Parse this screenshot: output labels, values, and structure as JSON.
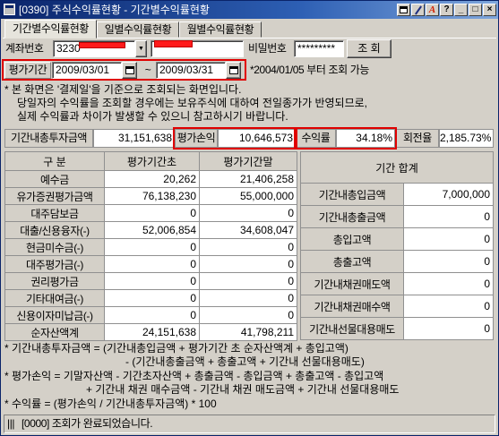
{
  "colors": {
    "title_bar": "#0a246a",
    "highlight": "#e00000",
    "redaction": "#ff1a1a",
    "panel": "#d4d0c8"
  },
  "window": {
    "title": "[0390] 주식수익률현황 - 기간별수익률현황",
    "title_buttons": [
      {
        "icon": "window-icon"
      },
      {
        "icon": "link-icon"
      },
      {
        "icon": "font-icon",
        "glyph": "A"
      },
      {
        "icon": "help-icon",
        "glyph": "?"
      },
      {
        "icon": "minimize-icon",
        "glyph": "_"
      },
      {
        "icon": "maximize-icon",
        "glyph": "□"
      },
      {
        "icon": "close-icon",
        "glyph": "×"
      }
    ]
  },
  "tabs": [
    {
      "label": "기간별수익률현황",
      "active": true
    },
    {
      "label": "일별수익률현황",
      "active": false
    },
    {
      "label": "월별수익률현황",
      "active": false
    }
  ],
  "account": {
    "label": "계좌번호",
    "number": "3230",
    "dropdown_glyph": "▼",
    "password_label": "비밀번호",
    "password": "*********",
    "search_button": "조 회"
  },
  "period": {
    "label": "평가기간",
    "start": "2009/03/01",
    "separator": "~",
    "end": "2009/03/31",
    "note": "*2004/01/05 부터 조회 가능"
  },
  "notes": [
    "* 본 화면은 '결제일'을 기준으로 조회되는 화면입니다.",
    "당일자의 수익률을 조회할 경우에는 보유주식에 대하여 전일종가가 반영되므로,",
    "실제 수익률과 차이가 발생할 수 있으니 참고하시기 바랍니다."
  ],
  "summary": {
    "total_investment": {
      "label": "기간내총투자금액",
      "value": "31,151,638"
    },
    "profit_loss": {
      "label": "평가손익",
      "value": "10,646,573"
    },
    "return_rate": {
      "label": "수익률",
      "value": "34.18%"
    },
    "turnover": {
      "label": "회전율",
      "value": "2,185.73%"
    }
  },
  "asset_table": {
    "headers": [
      "구 분",
      "평가기간초",
      "평가기간말"
    ],
    "rows": [
      {
        "label": "예수금",
        "start": "20,262",
        "end": "21,406,258"
      },
      {
        "label": "유가증권평가금액",
        "start": "76,138,230",
        "end": "55,000,000"
      },
      {
        "label": "대주담보금",
        "start": "0",
        "end": "0"
      },
      {
        "label": "대출/신용융자(-)",
        "start": "52,006,854",
        "end": "34,608,047"
      },
      {
        "label": "현금미수금(-)",
        "start": "0",
        "end": "0"
      },
      {
        "label": "대주평가금(-)",
        "start": "0",
        "end": "0"
      },
      {
        "label": "권리평가금",
        "start": "0",
        "end": "0"
      },
      {
        "label": "기타대여금(-)",
        "start": "0",
        "end": "0"
      },
      {
        "label": "신용이자미납금(-)",
        "start": "0",
        "end": "0"
      },
      {
        "label": "순자산액계",
        "start": "24,151,638",
        "end": "41,798,211"
      }
    ]
  },
  "period_totals": {
    "header": "기간 합계",
    "rows": [
      {
        "label": "기간내총입금액",
        "value": "7,000,000"
      },
      {
        "label": "기간내총출금액",
        "value": "0"
      },
      {
        "label": "총입고액",
        "value": "0"
      },
      {
        "label": "총출고액",
        "value": "0"
      },
      {
        "label": "기간내채권매도액",
        "value": "0"
      },
      {
        "label": "기간내채권매수액",
        "value": "0"
      },
      {
        "label": "기간내선물대용매도",
        "value": "0"
      }
    ]
  },
  "formulas": [
    "* 기간내총투자금액 = (기간내총입금액 + 평가기간 초 순자산액계 + 총입고액)",
    "- (기간내총출금액 + 총출고액 + 기간내 선물대용매도)",
    "* 평가손익 = 기말자산액 - 기간초자산액 + 총출금액 - 총입금액 + 총출고액 - 총입고액",
    "+ 기간내 채권 매수금액 - 기간내 채권 매도금액 + 기간내 선물대용매도",
    "* 수익률 = (평가손익 / 기간내총투자금액) * 100"
  ],
  "status": {
    "grip": "|||",
    "message": "[0000] 조회가 완료되었습니다."
  }
}
